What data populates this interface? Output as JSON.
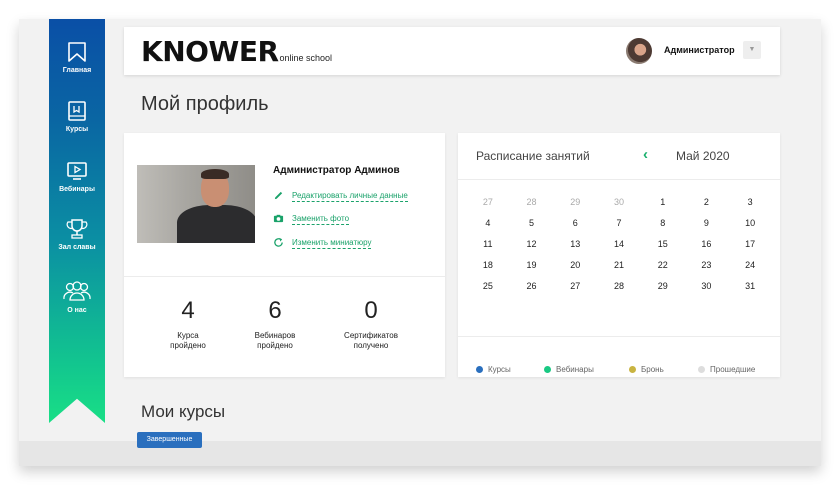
{
  "sidebar": {
    "items": [
      {
        "label": "Главная",
        "icon": "bookmark-icon"
      },
      {
        "label": "Курсы",
        "icon": "book-icon"
      },
      {
        "label": "Вебинары",
        "icon": "monitor-play-icon"
      },
      {
        "label": "Зал славы",
        "icon": "trophy-icon"
      },
      {
        "label": "О нас",
        "icon": "group-icon"
      }
    ],
    "gradient": [
      "#0a4fa6",
      "#19df86"
    ]
  },
  "header": {
    "logo_main": "KNOWER",
    "logo_sub": "online school",
    "user_name": "Администратор",
    "dropdown_icon": "▼"
  },
  "main": {
    "page_title": "Мой профиль",
    "profile": {
      "name": "Администратор Админов",
      "actions": [
        {
          "label": "Редактировать личные данные",
          "icon": "pencil-icon"
        },
        {
          "label": "Заменить фото",
          "icon": "camera-icon"
        },
        {
          "label": "Изменить миниатюру",
          "icon": "refresh-icon"
        }
      ],
      "stats": [
        {
          "value": "4",
          "label": "Курса\nпройдено"
        },
        {
          "value": "6",
          "label": "Вебинаров\nпройдено"
        },
        {
          "value": "0",
          "label": "Сертификатов\nполучено"
        }
      ]
    },
    "calendar": {
      "title": "Расписание занятий",
      "prev_icon": "‹",
      "month": "Май 2020",
      "weeks": [
        [
          {
            "d": "27",
            "past": true
          },
          {
            "d": "28",
            "past": true
          },
          {
            "d": "29",
            "past": true
          },
          {
            "d": "30",
            "past": true
          },
          {
            "d": "1"
          },
          {
            "d": "2"
          },
          {
            "d": "3"
          }
        ],
        [
          {
            "d": "4"
          },
          {
            "d": "5"
          },
          {
            "d": "6"
          },
          {
            "d": "7"
          },
          {
            "d": "8"
          },
          {
            "d": "9"
          },
          {
            "d": "10"
          }
        ],
        [
          {
            "d": "11"
          },
          {
            "d": "12"
          },
          {
            "d": "13"
          },
          {
            "d": "14"
          },
          {
            "d": "15"
          },
          {
            "d": "16"
          },
          {
            "d": "17"
          }
        ],
        [
          {
            "d": "18"
          },
          {
            "d": "19"
          },
          {
            "d": "20"
          },
          {
            "d": "21"
          },
          {
            "d": "22"
          },
          {
            "d": "23"
          },
          {
            "d": "24"
          }
        ],
        [
          {
            "d": "25"
          },
          {
            "d": "26"
          },
          {
            "d": "27"
          },
          {
            "d": "28"
          },
          {
            "d": "29"
          },
          {
            "d": "30"
          },
          {
            "d": "31"
          }
        ]
      ],
      "legend": [
        {
          "label": "Курсы",
          "color": "#2a6fbe"
        },
        {
          "label": "Вебинары",
          "color": "#19c983"
        },
        {
          "label": "Бронь",
          "color": "#c9b441"
        },
        {
          "label": "Прошедшие",
          "color": "#dddddd"
        }
      ]
    },
    "courses_title": "Мои курсы",
    "courses_filter": "Завершенные"
  },
  "colors": {
    "accent": "#19b06d",
    "badge": "#2a6fbe"
  }
}
